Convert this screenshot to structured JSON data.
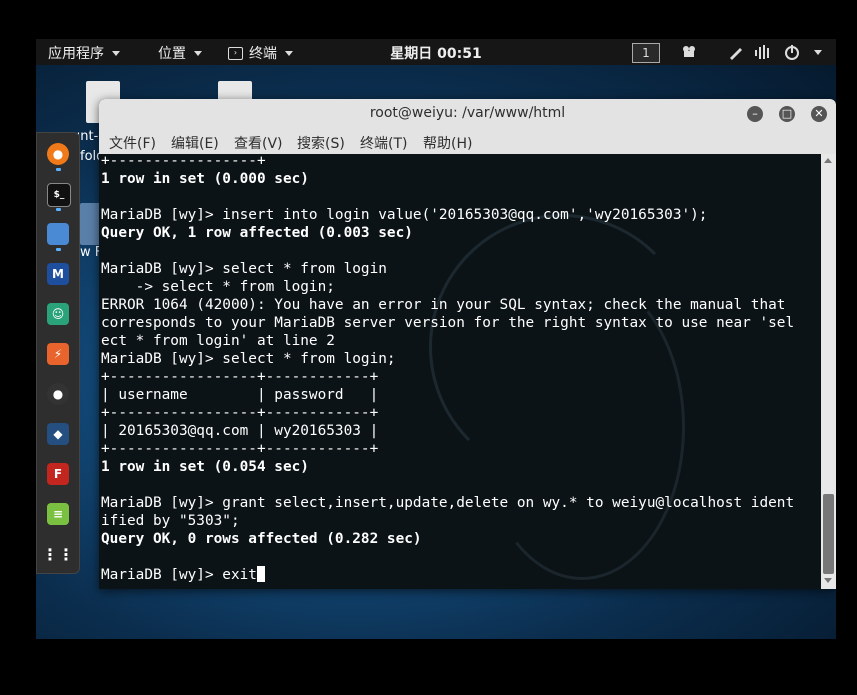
{
  "topbar": {
    "applications": "应用程序",
    "places": "位置",
    "terminal_app": "终端",
    "clock": "星期日 00:51",
    "workspace": "1"
  },
  "desktop": {
    "icons": [
      {
        "label": "unt-"
      },
      {
        "label": "folders"
      },
      {
        "label": "ew Folder"
      }
    ]
  },
  "dock": {
    "items": [
      "firefox-icon",
      "terminal-icon",
      "files-icon",
      "metasploit-icon",
      "armitage-icon",
      "burpsuite-icon",
      "maltego-icon",
      "beef-icon",
      "faraday-icon",
      "leafpad-icon",
      "show-apps-icon"
    ]
  },
  "window": {
    "title": "root@weiyu: /var/www/html",
    "menu": [
      "文件(F)",
      "编辑(E)",
      "查看(V)",
      "搜索(S)",
      "终端(T)",
      "帮助(H)"
    ]
  },
  "terminal": {
    "lines": [
      {
        "text": "+-----------------+",
        "bold": false
      },
      {
        "text": "1 row in set (0.000 sec)",
        "bold": true
      },
      {
        "text": "",
        "bold": false
      },
      {
        "text": "MariaDB [wy]> insert into login value('20165303@qq.com','wy20165303');",
        "bold": false
      },
      {
        "text": "Query OK, 1 row affected (0.003 sec)",
        "bold": true
      },
      {
        "text": "",
        "bold": false
      },
      {
        "text": "MariaDB [wy]> select * from login",
        "bold": false
      },
      {
        "text": "    -> select * from login;",
        "bold": false
      },
      {
        "text": "ERROR 1064 (42000): You have an error in your SQL syntax; check the manual that",
        "bold": false
      },
      {
        "text": "corresponds to your MariaDB server version for the right syntax to use near 'sel",
        "bold": false
      },
      {
        "text": "ect * from login' at line 2",
        "bold": false
      },
      {
        "text": "MariaDB [wy]> select * from login;",
        "bold": false
      },
      {
        "text": "+-----------------+------------+",
        "bold": false
      },
      {
        "text": "| username        | password   |",
        "bold": false
      },
      {
        "text": "+-----------------+------------+",
        "bold": false
      },
      {
        "text": "| 20165303@qq.com | wy20165303 |",
        "bold": false
      },
      {
        "text": "+-----------------+------------+",
        "bold": false
      },
      {
        "text": "1 row in set (0.054 sec)",
        "bold": true
      },
      {
        "text": "",
        "bold": false
      },
      {
        "text": "MariaDB [wy]> grant select,insert,update,delete on wy.* to weiyu@localhost ident",
        "bold": false
      },
      {
        "text": "ified by \"5303\";",
        "bold": false
      },
      {
        "text": "Query OK, 0 rows affected (0.282 sec)",
        "bold": true
      },
      {
        "text": "",
        "bold": false
      },
      {
        "text": "MariaDB [wy]> exit",
        "bold": false,
        "cursor": true
      }
    ]
  },
  "colors": {
    "terminal_bg": "#0c1317",
    "topbar_bg": "#161616",
    "titlebar_bg": "#e3e3e3"
  }
}
